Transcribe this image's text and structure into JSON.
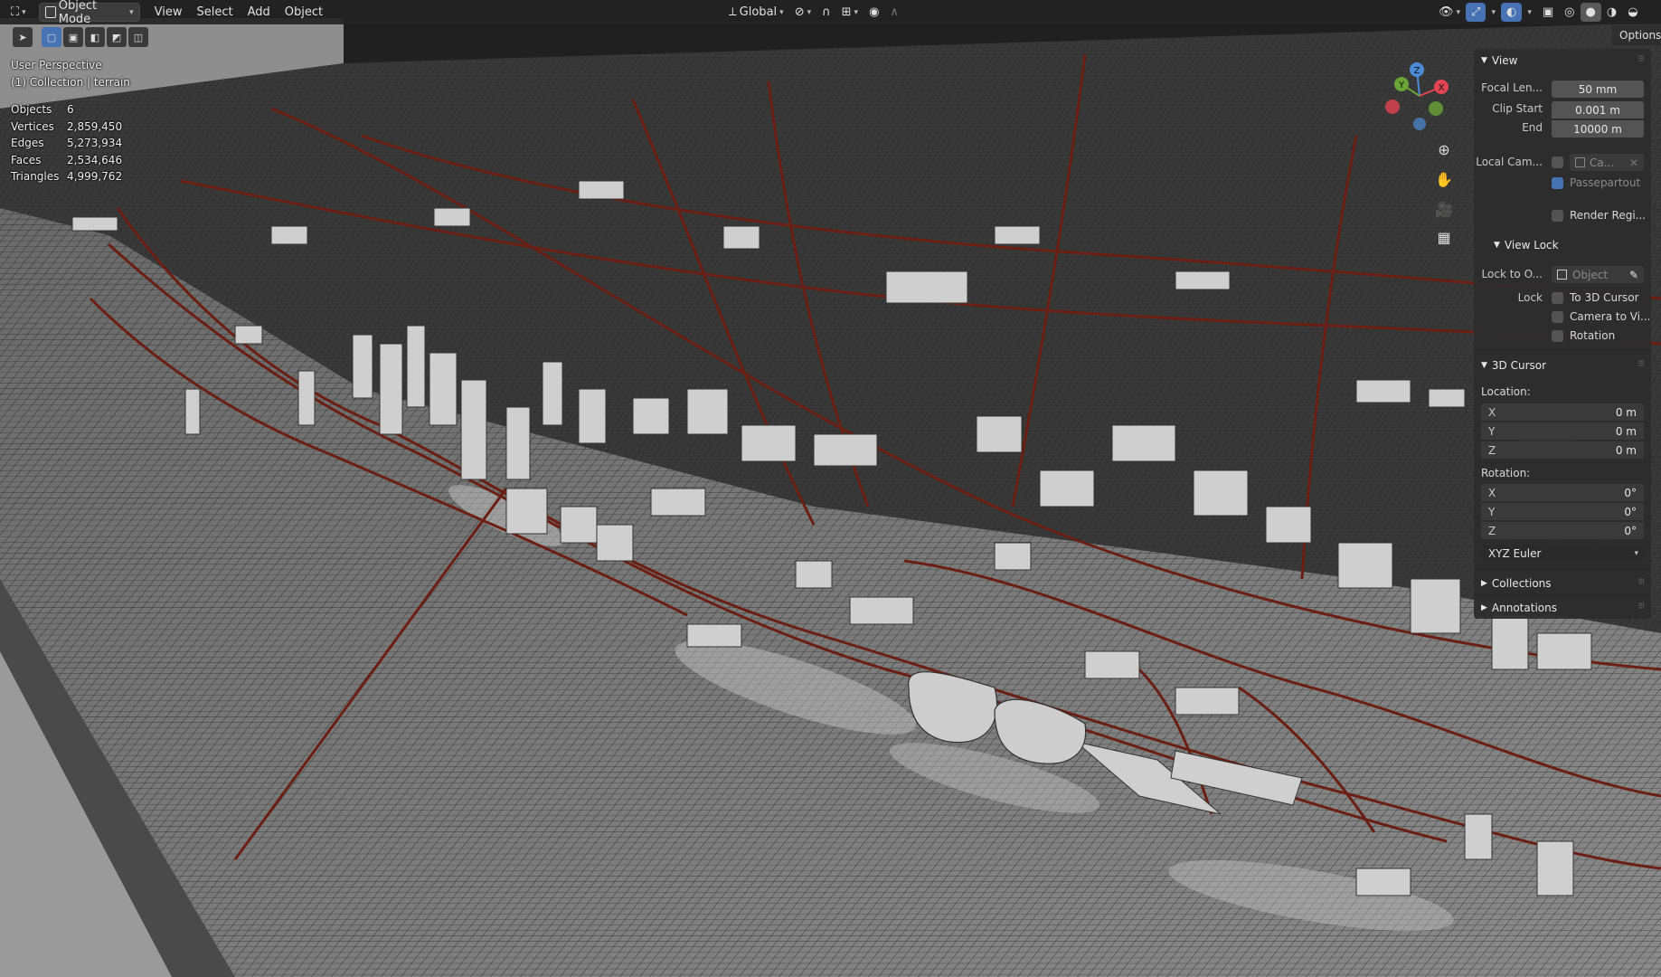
{
  "header": {
    "mode_label": "Object Mode",
    "menus": [
      "View",
      "Select",
      "Add",
      "Object"
    ],
    "orientation_label": "Global",
    "icons": {
      "editor_type": "viewport-editor-icon",
      "mode": "object-mode-icon",
      "orientation": "transform-orientation-icon",
      "pivot": "pivot-point-icon",
      "snap": "snap-magnet-icon",
      "proportional": "proportional-editing-icon",
      "visibility": "eye-visibility-icon",
      "gizmo": "gizmo-toggle-icon",
      "overlay": "overlay-toggle-icon",
      "xray": "xray-toggle-icon",
      "shading": [
        "wireframe-shading-icon",
        "solid-shading-icon",
        "material-shading-icon",
        "rendered-shading-icon"
      ]
    }
  },
  "overlay": {
    "view_name": "User Perspective",
    "collection": "(1) Collection | terrain",
    "stats": [
      {
        "label": "Objects",
        "value": "6"
      },
      {
        "label": "Vertices",
        "value": "2,859,450"
      },
      {
        "label": "Edges",
        "value": "5,273,934"
      },
      {
        "label": "Faces",
        "value": "2,534,646"
      },
      {
        "label": "Triangles",
        "value": "4,999,762"
      }
    ]
  },
  "gizmo": {
    "x": "X",
    "y": "Y",
    "z": "Z"
  },
  "options_label": "Options",
  "sidebar": {
    "view": {
      "title": "View",
      "focal_length_label": "Focal Len...",
      "focal_length_value": "50 mm",
      "clip_start_label": "Clip Start",
      "clip_start_value": "0.001 m",
      "clip_end_label": "End",
      "clip_end_value": "10000 m",
      "local_camera_label": "Local Cam...",
      "local_camera_value": "Ca...",
      "passepartout_label": "Passepartout",
      "render_region_label": "Render Regi..."
    },
    "view_lock": {
      "title": "View Lock",
      "lock_to_object_label": "Lock to O...",
      "lock_to_object_placeholder": "Object",
      "lock_label": "Lock",
      "to_3d_cursor_label": "To 3D Cursor",
      "camera_to_view_label": "Camera to Vi...",
      "rotation_label": "Rotation"
    },
    "cursor": {
      "title": "3D Cursor",
      "location_label": "Location:",
      "location": [
        {
          "axis": "X",
          "value": "0 m"
        },
        {
          "axis": "Y",
          "value": "0 m"
        },
        {
          "axis": "Z",
          "value": "0 m"
        }
      ],
      "rotation_label": "Rotation:",
      "rotation": [
        {
          "axis": "X",
          "value": "0°"
        },
        {
          "axis": "Y",
          "value": "0°"
        },
        {
          "axis": "Z",
          "value": "0°"
        }
      ],
      "rotation_mode": "XYZ Euler"
    },
    "collections_title": "Collections",
    "annotations_title": "Annotations"
  },
  "colors": {
    "accent": "#4772b3",
    "road": "#6b1f12",
    "building": "#d0d0d0",
    "terrain": "#707070",
    "axis_x": "#e34452",
    "axis_y": "#6aa537",
    "axis_z": "#4b8bd6"
  }
}
